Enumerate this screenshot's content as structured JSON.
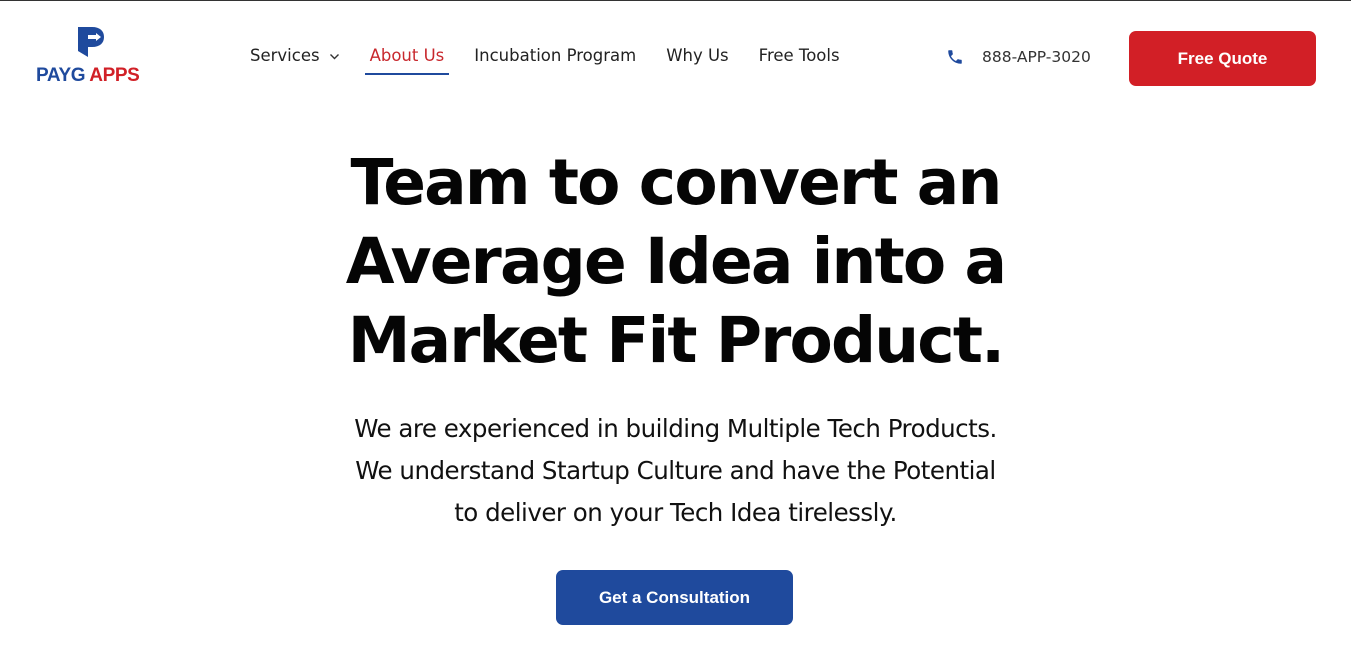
{
  "brand": {
    "name_part1": "PAYG",
    "name_part2": " APPS",
    "primary_color": "#1f4a9d",
    "accent_color": "#d12027",
    "logo_icon": "arrow-p-logo-icon"
  },
  "nav": {
    "items": [
      {
        "label": "Services",
        "has_dropdown": true
      },
      {
        "label": "About Us",
        "active": true
      },
      {
        "label": "Incubation Program"
      },
      {
        "label": "Why Us"
      },
      {
        "label": "Free Tools"
      }
    ],
    "dropdown_icon": "chevron-down-icon"
  },
  "contact": {
    "phone_icon": "phone-icon",
    "phone": "888-APP-3020"
  },
  "cta": {
    "quote_label": "Free Quote",
    "consult_label": "Get a Consultation"
  },
  "hero": {
    "title_lines": [
      "Team to convert an",
      "Average Idea into a",
      "Market Fit Product."
    ],
    "subtitle_lines": [
      "We are experienced in building Multiple Tech Products.",
      "We understand Startup Culture and have the Potential",
      "to deliver on your Tech Idea tirelessly."
    ]
  }
}
